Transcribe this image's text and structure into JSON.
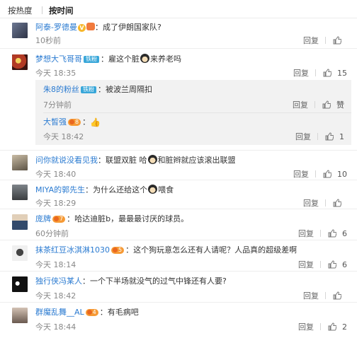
{
  "sort_tabs": {
    "hot": "按热度",
    "time": "按时间"
  },
  "actions": {
    "reply": "回复",
    "like_word": "赞"
  },
  "comments": [
    {
      "user": "阿泰-罗德曼",
      "text": "：成了伊朗国家队?",
      "time": "10秒前",
      "likes": "",
      "avatar": "#4a5368"
    },
    {
      "user": "梦想大飞哥哥",
      "badge": "铁粉",
      "text": "：雇这个脏",
      "text2": "来养老吗",
      "time": "今天 18:35",
      "likes": "15",
      "avatar": "#6b1e17"
    },
    {
      "user": "大皙强",
      "badge": "",
      "text": "：",
      "time": "今天 18:42",
      "likes": "1"
    },
    {
      "user": "问你就说没看见我",
      "text": "：联盟双脏 哈",
      "text2": "和脏辫就应该滚出联盟",
      "time": "今天 18:40",
      "likes": "10",
      "avatar": "#8a7d6a"
    },
    {
      "user": "MIYA的郭先生",
      "text": "：为什么还给这个",
      "text2": "喂食",
      "time": "今天 18:29",
      "likes": "",
      "avatar": "#565a5e"
    },
    {
      "user": "庞牌",
      "text": "：哈达迪脏b，最最最讨厌的球员。",
      "time": "60分钟前",
      "likes": "6",
      "avatar": "#3c5478"
    },
    {
      "user": "抹茶红豆冰淇淋1030",
      "text": "：这个狗玩意怎么还有人请呢？人品真的超级差啊",
      "time": "今天 18:14",
      "likes": "6",
      "avatar": "#d8d8d8"
    },
    {
      "user": "独行侠冯某人",
      "text": "：一个下半场就没气的过气中锋还有人要?",
      "time": "今天 18:42",
      "likes": "",
      "avatar": "#222222"
    },
    {
      "user": "群魔乱舞__AL",
      "text": "：有毛病吧",
      "time": "今天 18:44",
      "likes": "2",
      "avatar": "#7a6c62"
    }
  ],
  "replies": [
    {
      "user": "朱8的粉丝",
      "badge": "铁粉",
      "text": "：被波兰周隔扣",
      "time": "7分钟前",
      "like_label": "赞"
    }
  ]
}
